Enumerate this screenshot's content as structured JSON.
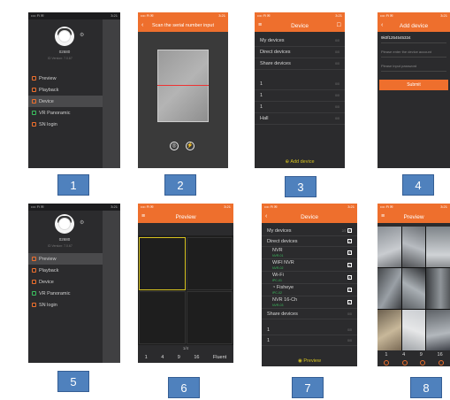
{
  "badges": [
    "1",
    "2",
    "3",
    "4",
    "5",
    "6",
    "7",
    "8"
  ],
  "status": {
    "left": "•••• Fi ✉",
    "time": "3:21",
    "right": "92%"
  },
  "side_menu": {
    "username": "02680",
    "version": "ID Version: 7.0.67",
    "items": [
      "Preview",
      "Playback",
      "Device",
      "VR Panoramic",
      "SN login"
    ]
  },
  "panel2": {
    "title": "Scan the serial number input"
  },
  "panel3": {
    "title": "Device",
    "rows": [
      {
        "label": "My devices",
        "count": "0/0"
      },
      {
        "label": "Direct devices",
        "count": "0/0"
      },
      {
        "label": "Share devices",
        "count": "0/0"
      },
      {
        "label": "1",
        "count": "0/0"
      },
      {
        "label": "1",
        "count": "0/0"
      },
      {
        "label": "1",
        "count": "0/0"
      },
      {
        "label": "Hall",
        "count": "0/0"
      }
    ],
    "add": "Add device"
  },
  "panel4": {
    "title": "Add device",
    "serial": "9k0f1254545334",
    "account_placeholder": "Please enter the device account",
    "password_placeholder": "Please input password",
    "submit": "Submit"
  },
  "panel6": {
    "title": "Preview",
    "page": "1/4",
    "layouts": [
      "1",
      "4",
      "9",
      "16",
      "Fluent"
    ]
  },
  "panel7": {
    "title": "Device",
    "rows": [
      {
        "label": "My devices",
        "count": "2/2"
      },
      {
        "label": "Direct devices",
        "count": "0/0"
      },
      {
        "label": "NVR",
        "sub": "NVR-01"
      },
      {
        "label": "WIFI NVR",
        "sub": "NVR-02"
      },
      {
        "label": "Wi-Fi",
        "sub": "IPC-01"
      },
      {
        "label": "Fisheye",
        "sub": "IPC-02"
      },
      {
        "label": "NVR 16-Ch",
        "sub": "NVR-03"
      },
      {
        "label": "Share devices",
        "count": "0/0"
      },
      {
        "label": "1",
        "count": "0/0"
      },
      {
        "label": "1",
        "count": "0/0"
      }
    ],
    "preview": "Preview"
  },
  "panel8": {
    "title": "Preview",
    "layouts": [
      "1",
      "4",
      "9",
      "16"
    ]
  },
  "colors": {
    "accent": "#ee6f2d",
    "panel": "#2b2b2d",
    "badge": "#4f81bd"
  }
}
